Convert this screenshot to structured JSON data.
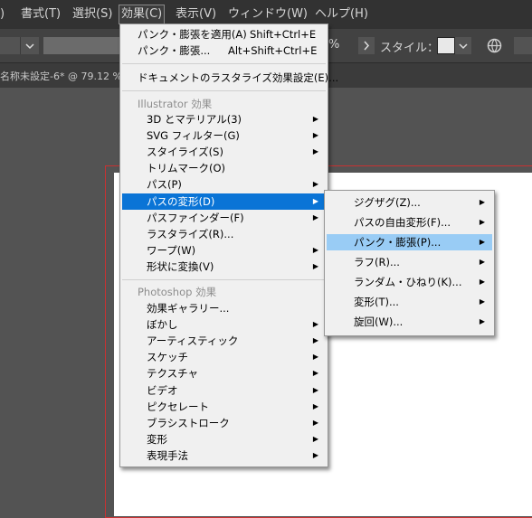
{
  "menubar": {
    "items": [
      {
        "label": ")",
        "name": "menu-partial"
      },
      {
        "label": "書式(T)",
        "name": "menu-type"
      },
      {
        "label": "選択(S)",
        "name": "menu-select"
      },
      {
        "label": "効果(C)",
        "name": "menu-effect"
      },
      {
        "label": "表示(V)",
        "name": "menu-view"
      },
      {
        "label": "ウィンドウ(W)",
        "name": "menu-window"
      },
      {
        "label": "ヘルプ(H)",
        "name": "menu-help"
      }
    ]
  },
  "toolbar": {
    "percent": "%",
    "style_label": "スタイル："
  },
  "tab": {
    "title": "名称未設定-6* @ 79.12 %"
  },
  "effect_menu": {
    "apply_last": "パンク・膨張を適用(A)",
    "apply_last_shortcut": "Shift+Ctrl+E",
    "last_effect": "パンク・膨張...",
    "last_effect_shortcut": "Alt+Shift+Ctrl+E",
    "doc_raster": "ドキュメントのラスタライズ効果設定(E)...",
    "illustrator_section": "Illustrator 効果",
    "illustrator_items": [
      {
        "label": "3D とマテリアル(3)",
        "sub": true
      },
      {
        "label": "SVG フィルター(G)",
        "sub": true
      },
      {
        "label": "スタイライズ(S)",
        "sub": true
      },
      {
        "label": "トリムマーク(O)",
        "sub": false
      },
      {
        "label": "パス(P)",
        "sub": true
      },
      {
        "label": "パスの変形(D)",
        "sub": true
      },
      {
        "label": "パスファインダー(F)",
        "sub": true
      },
      {
        "label": "ラスタライズ(R)...",
        "sub": false
      },
      {
        "label": "ワープ(W)",
        "sub": true
      },
      {
        "label": "形状に変換(V)",
        "sub": true
      }
    ],
    "photoshop_section": "Photoshop 効果",
    "photoshop_items": [
      {
        "label": "効果ギャラリー...",
        "sub": false
      },
      {
        "label": "ぼかし",
        "sub": true
      },
      {
        "label": "アーティスティック",
        "sub": true
      },
      {
        "label": "スケッチ",
        "sub": true
      },
      {
        "label": "テクスチャ",
        "sub": true
      },
      {
        "label": "ビデオ",
        "sub": true
      },
      {
        "label": "ピクセレート",
        "sub": true
      },
      {
        "label": "ブラシストローク",
        "sub": true
      },
      {
        "label": "変形",
        "sub": true
      },
      {
        "label": "表現手法",
        "sub": true
      }
    ]
  },
  "distort_submenu": {
    "items": [
      "ジグザグ(Z)...",
      "パスの自由変形(F)...",
      "パンク・膨張(P)...",
      "ラフ(R)...",
      "ランダム・ひねり(K)...",
      "変形(T)...",
      "旋回(W)..."
    ]
  },
  "colors": {
    "highlight": "#0a74d6",
    "hover": "#99ccf5",
    "menubar": "#323232",
    "artboard_border": "#c83232"
  },
  "icons": {
    "submenu_arrow": "▶",
    "dropdown": "chevron-down-icon",
    "style_dropdown": "chevron-down-icon",
    "next": "chevron-right-icon",
    "globe": "globe-icon"
  }
}
